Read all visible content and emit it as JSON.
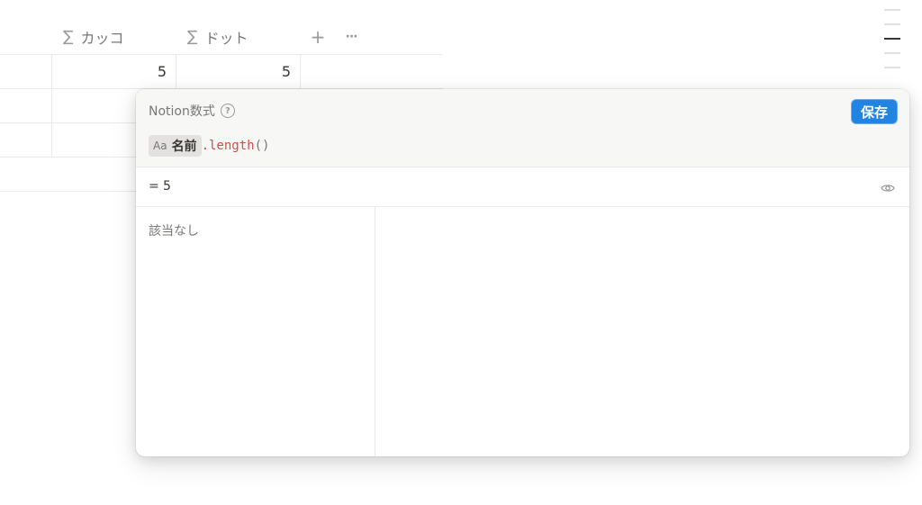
{
  "table": {
    "columns": [
      {
        "icon": "sigma-icon",
        "label": "カッコ"
      },
      {
        "icon": "sigma-icon",
        "label": "ドット"
      }
    ],
    "add_column_glyph": "+",
    "more_glyph": "···",
    "rows": [
      {
        "kakko": "5",
        "dot": "5"
      }
    ]
  },
  "formula_editor": {
    "title": "Notion数式",
    "help_glyph": "?",
    "save_label": "保存",
    "expression": {
      "property_type": "Aa",
      "property_name": "名前",
      "dot": ".",
      "function": "length",
      "parens": "()"
    },
    "result": {
      "equals": "=",
      "value": "5"
    },
    "suggestions_empty": "該当なし"
  },
  "colors": {
    "accent": "#2383e2",
    "function_name": "#d44c47",
    "muted_text": "#787774",
    "border": "#e9e9e7"
  }
}
